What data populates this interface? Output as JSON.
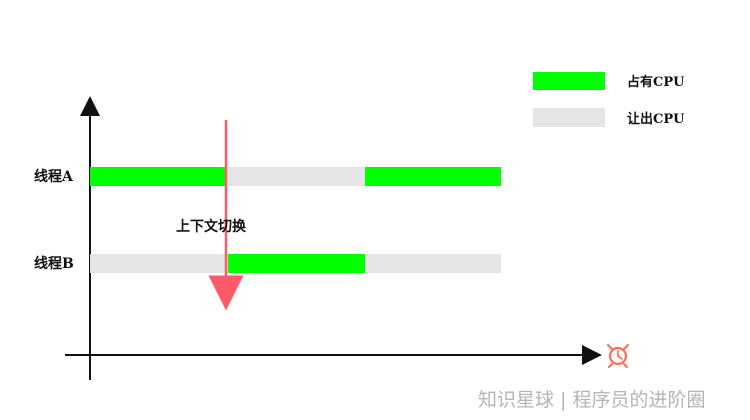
{
  "legend": {
    "cpu_occupied": "占有CPU",
    "cpu_yield": "让出CPU"
  },
  "threads": {
    "a": "线程A",
    "b": "线程B"
  },
  "context_switch": "上下文切换",
  "watermark": "知识星球 | 程序员的进阶圈",
  "icons": {
    "axis_end": "alarm-clock-icon"
  },
  "colors": {
    "occupied": "#00ff00",
    "yield": "#e5e5e5",
    "arrow": "#ff5a6a",
    "axis": "#111111"
  }
}
